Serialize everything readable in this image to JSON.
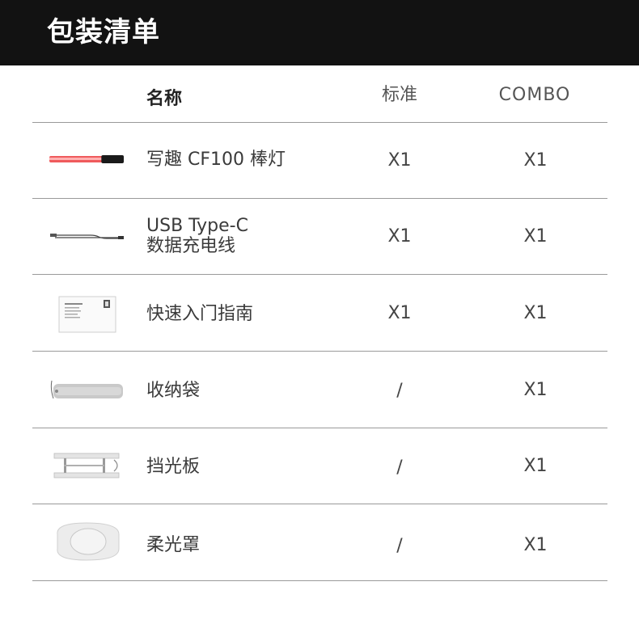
{
  "header": {
    "title": "包装清单"
  },
  "columns": {
    "name": "名称",
    "standard": "标准",
    "combo": "COMBO"
  },
  "rows": [
    {
      "icon": "light-wand-icon",
      "name": "写趣 CF100 棒灯",
      "name_line2": "",
      "standard": "X1",
      "combo": "X1"
    },
    {
      "icon": "usb-cable-icon",
      "name": "USB Type-C",
      "name_line2": "数据充电线",
      "standard": "X1",
      "combo": "X1"
    },
    {
      "icon": "quick-guide-icon",
      "name": "快速入门指南",
      "name_line2": "",
      "standard": "X1",
      "combo": "X1"
    },
    {
      "icon": "storage-bag-icon",
      "name": "收纳袋",
      "name_line2": "",
      "standard": "/",
      "combo": "X1"
    },
    {
      "icon": "barn-door-icon",
      "name": "挡光板",
      "name_line2": "",
      "standard": "/",
      "combo": "X1"
    },
    {
      "icon": "diffuser-icon",
      "name": "柔光罩",
      "name_line2": "",
      "standard": "/",
      "combo": "X1"
    }
  ],
  "colors": {
    "header_bg": "#121212",
    "rule": "#9a9a9a",
    "wand_red": "#e8383a"
  }
}
